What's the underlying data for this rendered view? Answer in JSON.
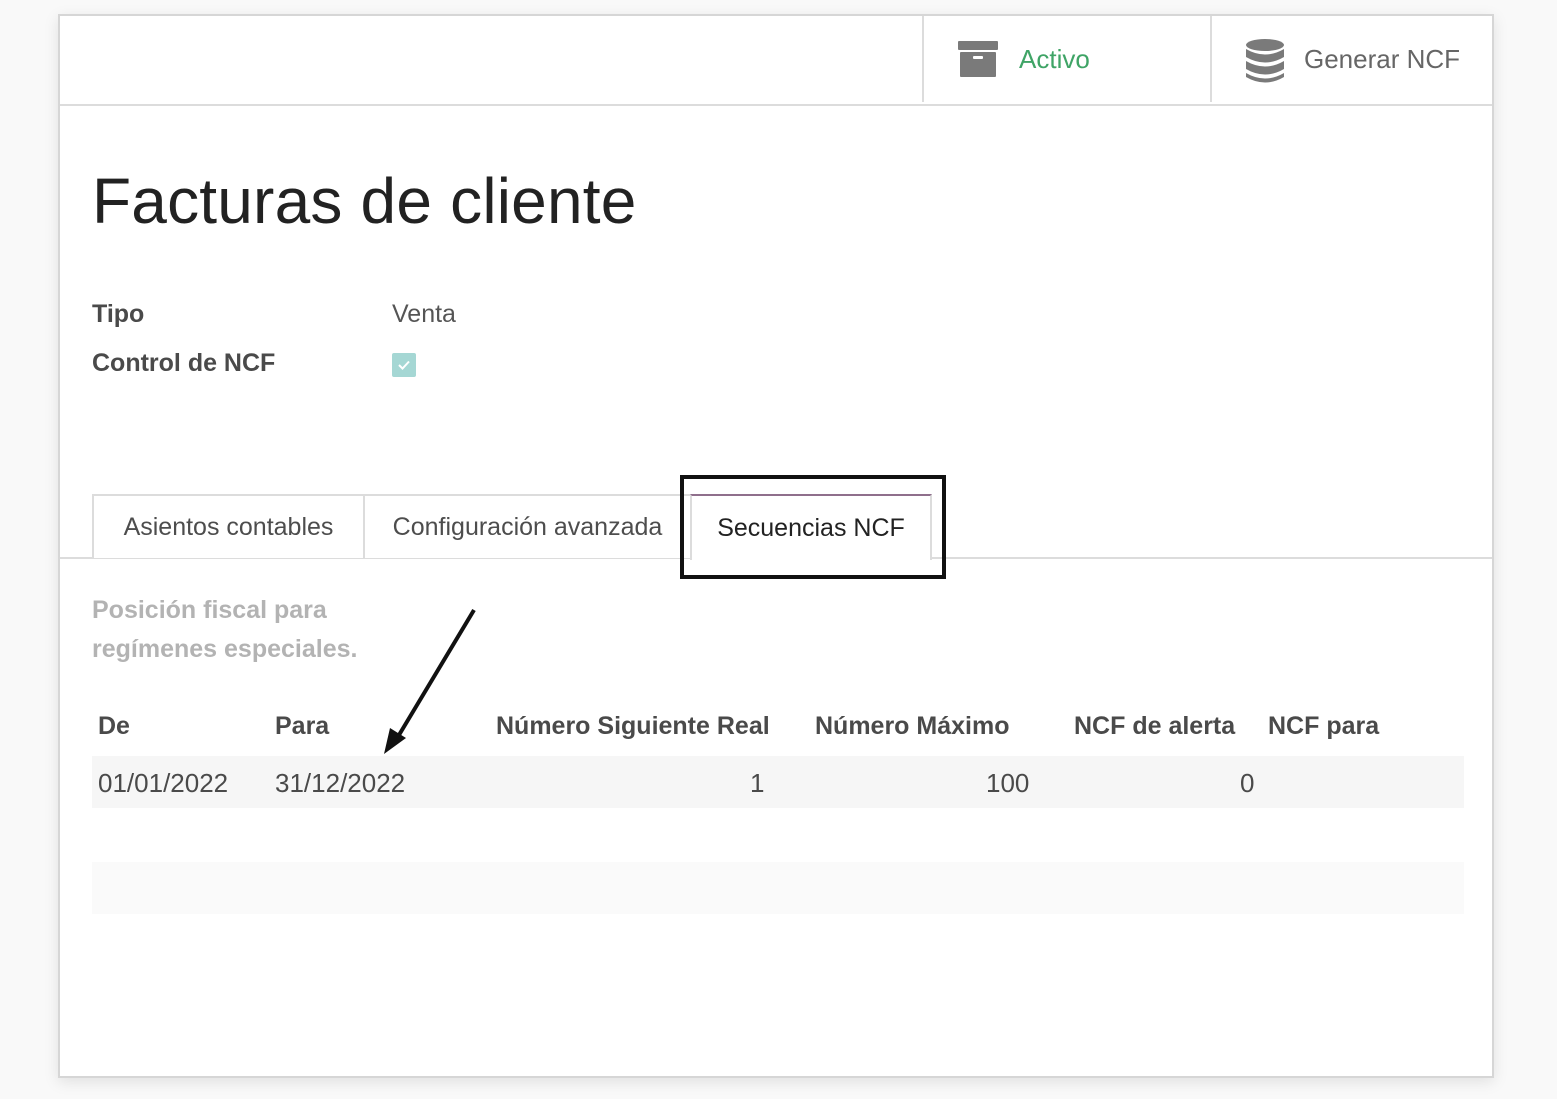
{
  "header": {
    "active_button": {
      "label": "Activo",
      "icon": "archive-icon",
      "color": "#3fa466"
    },
    "generate_button": {
      "label": "Generar NCF",
      "icon": "database-icon"
    }
  },
  "title": "Facturas de cliente",
  "fields": {
    "tipo_label": "Tipo",
    "tipo_value": "Venta",
    "control_label": "Control de NCF",
    "control_checked": true
  },
  "tabs": [
    {
      "label": "Asientos contables"
    },
    {
      "label": "Configuración avanzada"
    },
    {
      "label": "Secuencias NCF",
      "active": true
    }
  ],
  "help_text": "Posición fiscal para regímenes especiales.",
  "table": {
    "headers": [
      "De",
      "Para",
      "Número Siguiente Real",
      "Número Máximo",
      "NCF de alerta",
      "NCF para"
    ],
    "rows": [
      [
        "01/01/2022",
        "31/12/2022",
        "1",
        "100",
        "0",
        ""
      ]
    ]
  },
  "colors": {
    "highlight_border": "#111111",
    "active_tab_accent": "#8f6f8c",
    "checkbox": "#a5d7d4"
  }
}
